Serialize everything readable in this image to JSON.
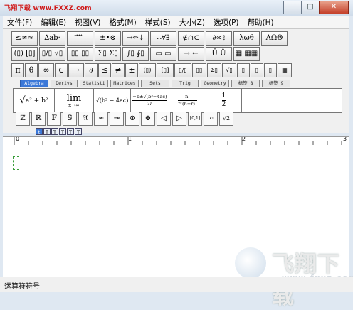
{
  "window": {
    "title": "飞翔下载 www.FXXZ.com",
    "buttons": {
      "minimize": "─",
      "maximize": "□",
      "close": "✕"
    }
  },
  "menu": [
    "文件(F)",
    "编辑(E)",
    "视图(V)",
    "格式(M)",
    "样式(S)",
    "大小(Z)",
    "选项(P)",
    "帮助(H)"
  ],
  "symbols_row1": [
    "≤≠≈",
    "∆ab·",
    "⃗ ⃗ ⃗",
    "±•⊗",
    "→⇔↓",
    "∴∀∃",
    "∉∩⊂",
    "∂∞ℓ",
    "λωθ",
    "ΛΩΘ"
  ],
  "templates_row2": [
    "(▯) [▯]",
    "▯/▯ √▯",
    "▯▯ ▯▯",
    "Σ▯ Σ▯",
    "∫▯ ∮▯",
    "▭ ▭",
    "→ ←",
    "Ū Ů",
    "▦ ▦▦"
  ],
  "symbols_row3": [
    "π",
    "θ",
    "∞",
    "∈",
    "→",
    "∂",
    "≤",
    "≠",
    "±",
    "(▯)",
    "[▯]",
    "▯/▯",
    "▯▯",
    "Σ▯",
    "√▯",
    "▯",
    "▯",
    "▯",
    "▦"
  ],
  "tabs": [
    "Algebra",
    "Derivs",
    "Statisti",
    "Matrices",
    "Sets",
    "Trig",
    "Geometry",
    "标签 8",
    "标签 9"
  ],
  "templates": {
    "algebra": {
      "a": "√",
      "b": "a² + b²"
    },
    "limit": {
      "top": "lim",
      "bottom": "x→∞"
    },
    "sqrt": "√(b² − 4ac)",
    "quadratic": {
      "num": "−b±√(b²−4ac)",
      "den": "2a"
    },
    "binomial": {
      "num": "n!",
      "den": "r!(n−r)!"
    },
    "half": {
      "num": "1",
      "den": "2"
    }
  },
  "symbols_row4": [
    "ℤ",
    "ℝ",
    "𝔽",
    "𝕊",
    "𝔄",
    "∞",
    "⊸",
    "⊗",
    "⊕",
    "◁",
    "▷",
    "[0,1]",
    "∞",
    "√2"
  ],
  "style_buttons": [
    "t",
    "T",
    "T",
    "T",
    "T",
    "T"
  ],
  "ruler": {
    "marks": [
      "0",
      "1",
      "2",
      "3"
    ]
  },
  "statusbar": {
    "text": "运算符符号"
  },
  "watermark": {
    "logo": "飞翔下载",
    "url": "www.fxxz.com"
  }
}
